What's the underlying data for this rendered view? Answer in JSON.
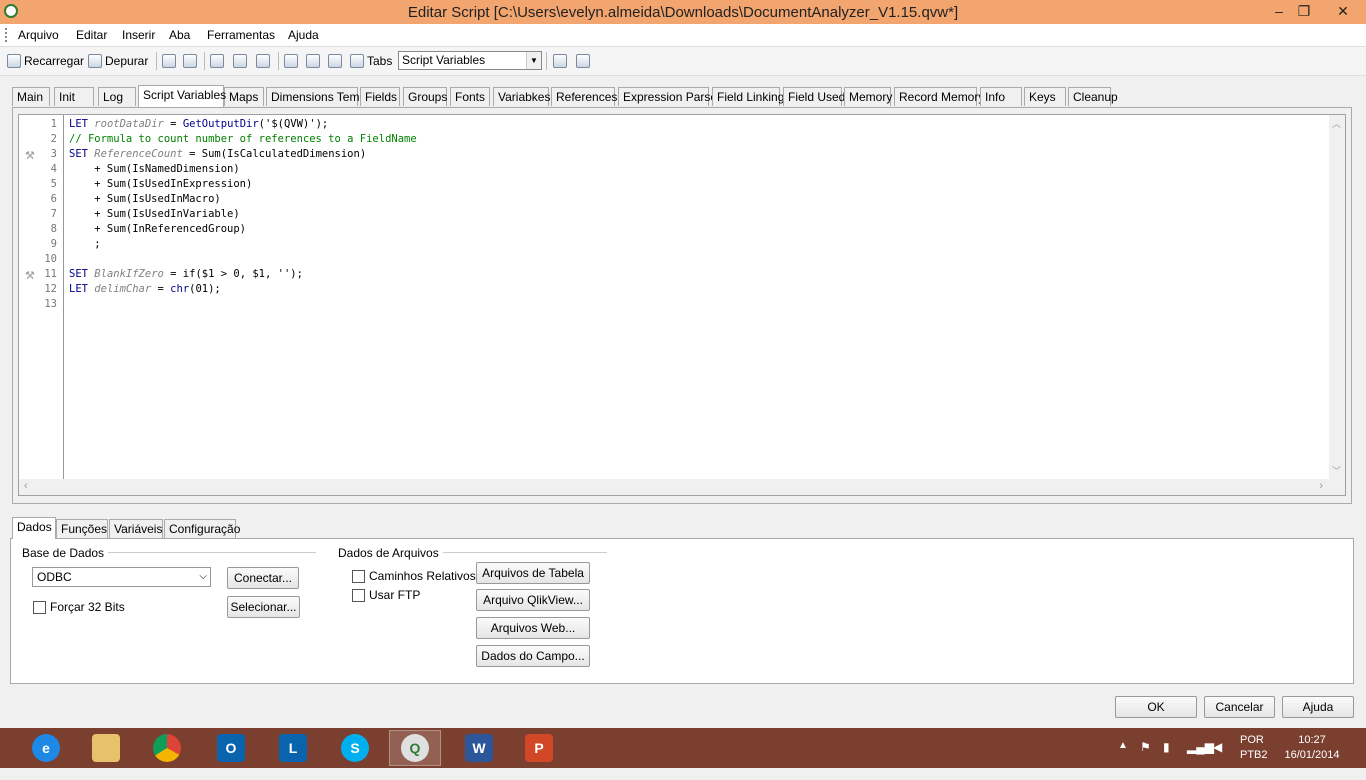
{
  "window": {
    "title": "Editar Script [C:\\Users\\evelyn.almeida\\Downloads\\DocumentAnalyzer_V1.15.qvw*]",
    "minimize": "–",
    "restore": "❐",
    "close": "✕"
  },
  "menu": [
    "Arquivo",
    "Editar",
    "Inserir",
    "Aba",
    "Ferramentas",
    "Ajuda"
  ],
  "toolbar": {
    "reload": "Recarregar",
    "debug": "Depurar",
    "tabs_label": "Tabs",
    "tab_selector_value": "Script Variables"
  },
  "script_tabs": [
    "Main",
    "Init",
    "Log",
    "Script Variables",
    "Maps",
    "Dimensions Temp",
    "Fields",
    "Groups",
    "Fonts",
    "Variabkes",
    "References",
    "Expression Parse",
    "Field Linking",
    "Field Used",
    "Memory",
    "Record Memory",
    "Info",
    "Keys",
    "Cleanup"
  ],
  "active_script_tab": "Script Variables",
  "script_lines": {
    "l1": {
      "kw": "LET",
      "var": "rootDataDir",
      "rest1": " = ",
      "fn": "GetOutputDir",
      "rest2": "('$(QVW)');"
    },
    "l2": "// Formula to count number of references to a FieldName",
    "l3": {
      "kw": "SET",
      "var": "ReferenceCount",
      "rest": " = Sum(IsCalculatedDimension)"
    },
    "l4": "    + Sum(IsNamedDimension)",
    "l5": "    + Sum(IsUsedInExpression)",
    "l6": "    + Sum(IsUsedInMacro)",
    "l7": "    + Sum(IsUsedInVariable)",
    "l8": "    + Sum(InReferencedGroup)",
    "l9": "    ;",
    "l10": "",
    "l11": {
      "kw": "SET",
      "var": "BlankIfZero",
      "rest": " = if($1 > 0, $1, '');"
    },
    "l12": {
      "kw": "LET",
      "var": "delimChar",
      "rest1": " = ",
      "fn": "chr",
      "rest2": "(01);"
    },
    "l13": ""
  },
  "line_numbers": [
    "1",
    "2",
    "3",
    "4",
    "5",
    "6",
    "7",
    "8",
    "9",
    "10",
    "11",
    "12",
    "13"
  ],
  "bottom_tabs": [
    "Dados",
    "Funções",
    "Variáveis",
    "Configuração"
  ],
  "active_bottom_tab": "Dados",
  "dados": {
    "db_group": "Base de Dados",
    "db_value": "ODBC",
    "connect": "Conectar...",
    "select": "Selecionar...",
    "force32": "Forçar 32 Bits",
    "files_group": "Dados de Arquivos",
    "relative_paths": "Caminhos Relativos",
    "use_ftp": "Usar FTP",
    "table_files": "Arquivos de Tabela ...",
    "qlikview_file": "Arquivo QlikView...",
    "web_files": "Arquivos Web...",
    "field_data": "Dados do Campo..."
  },
  "dialog_buttons": {
    "ok": "OK",
    "cancel": "Cancelar",
    "help": "Ajuda"
  },
  "taskbar": {
    "apps": [
      "ie-icon",
      "explorer-icon",
      "chrome-icon",
      "outlook-icon",
      "lync-icon",
      "skype-icon",
      "qlikview-icon",
      "word-icon",
      "powerpoint-icon"
    ],
    "lang": "POR",
    "layout": "PTB2",
    "time": "10:27",
    "date": "16/01/2014"
  },
  "colors": {
    "titlebar": "#f2a56e",
    "taskbar": "#7a3f2f",
    "keyword": "#00008b",
    "comment": "#008000",
    "variable": "#808080"
  }
}
